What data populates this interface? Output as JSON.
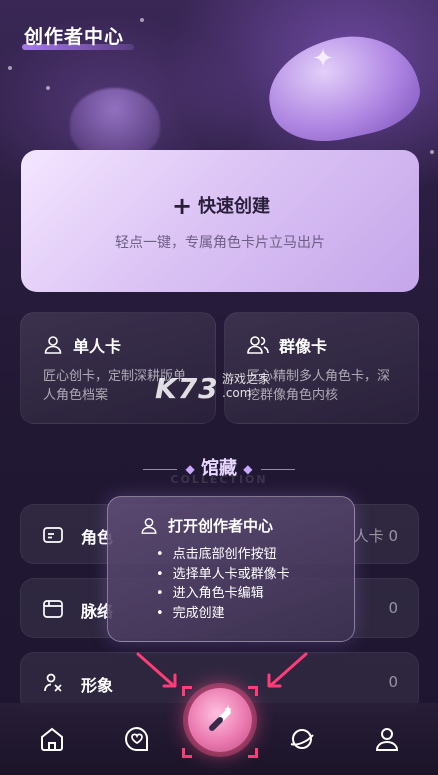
{
  "header": {
    "title": "创作者中心"
  },
  "quick_create": {
    "title": "快速创建",
    "subtitle": "轻点一键，专属角色卡片立马出片"
  },
  "single_card": {
    "title": "单人卡",
    "desc": "匠心创卡，定制深耕版单人角色档案"
  },
  "group_card": {
    "title": "群像卡",
    "desc": "匠心精制多人角色卡，深挖群像角色内核"
  },
  "watermark": {
    "brand": "K73",
    "line1": "游戏之家",
    "line2": ".com"
  },
  "collection": {
    "title": "馆藏",
    "subtitle": "COLLECTION"
  },
  "rows": [
    {
      "label": "角色",
      "count_label": "人卡",
      "count": "0",
      "icon": "card-icon"
    },
    {
      "label": "脉络",
      "count": "0",
      "icon": "window-icon"
    },
    {
      "label": "形象",
      "count": "0",
      "icon": "figure-icon"
    }
  ],
  "popup": {
    "title": "打开创作者中心",
    "steps": [
      "点击底部创作按钮",
      "选择单人卡或群像卡",
      "进入角色卡编辑",
      "完成创建"
    ]
  },
  "nav": [
    "home-icon",
    "chat-icon",
    "create-icon",
    "planet-icon",
    "profile-icon"
  ],
  "colors": {
    "accent": "#ff3c78",
    "card_light": "#e9d7ff",
    "background": "#211833"
  }
}
